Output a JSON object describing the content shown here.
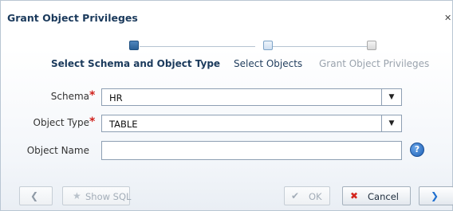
{
  "dialog": {
    "title": "Grant Object Privileges"
  },
  "train": {
    "steps": [
      {
        "label": "Select Schema and Object Type",
        "state": "current"
      },
      {
        "label": "Select Objects",
        "state": "next"
      },
      {
        "label": "Grant Object Privileges",
        "state": "disabled"
      }
    ]
  },
  "form": {
    "schema": {
      "label": "Schema",
      "required": "*",
      "value": "HR"
    },
    "object_type": {
      "label": "Object Type",
      "required": "*",
      "value": "TABLE"
    },
    "object_name": {
      "label": "Object Name",
      "value": ""
    },
    "help_icon": "?"
  },
  "buttons": {
    "back_icon": "back-chevron-icon",
    "show_sql": "Show SQL",
    "ok": "OK",
    "cancel": "Cancel",
    "next_icon": "next-chevron-icon"
  },
  "colors": {
    "accent": "#2b6096",
    "required": "#d0211c",
    "cancel_icon": "#d4261e"
  }
}
